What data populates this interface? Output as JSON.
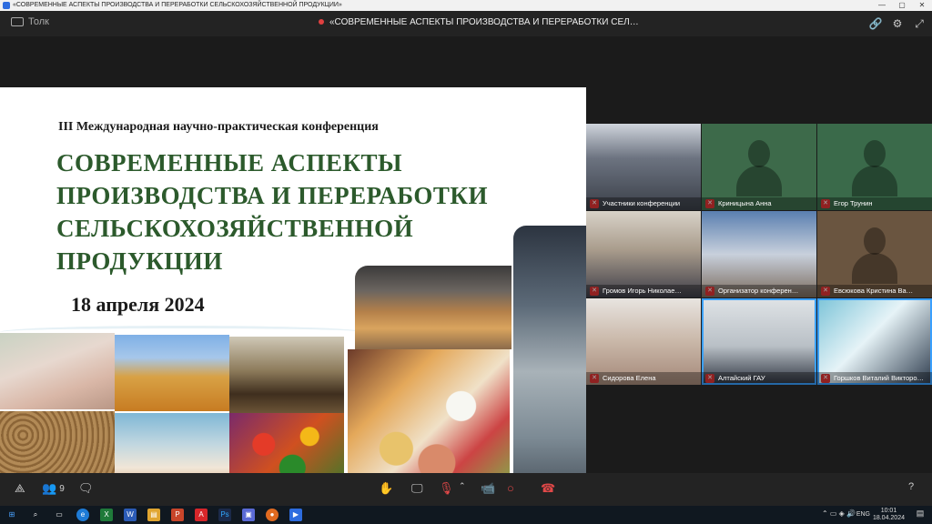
{
  "window": {
    "title": "«СОВРЕМЕННЫЕ АСПЕКТЫ ПРОИЗВОДСТВА И ПЕРЕРАБОТКИ СЕЛЬСКОХОЗЯЙСТВЕННОЙ ПРОДУКЦИИ»",
    "minimize": "—",
    "maximize": "▢",
    "close": "✕"
  },
  "header": {
    "app_name": "Толк",
    "meeting_title": "«СОВРЕМЕННЫЕ АСПЕКТЫ ПРОИЗВОДСТВА И ПЕРЕРАБОТКИ СЕЛ…",
    "recording_color": "#e04040"
  },
  "slide": {
    "subtitle": "III  Международная научно-практическая конференция",
    "title_lines": [
      "СОВРЕМЕННЫЕ АСПЕКТЫ",
      "ПРОИЗВОДСТВА И ПЕРЕРАБОТКИ",
      "СЕЛЬСКОХОЗЯЙСТВЕННОЙ",
      "ПРОДУКЦИИ"
    ],
    "date": "18 апреля 2024",
    "title_color": "#2c5a2c"
  },
  "participants": [
    {
      "name": "Участники конференции",
      "has_video": true
    },
    {
      "name": "Криницына Анна",
      "has_video": false
    },
    {
      "name": "Егор Трунин",
      "has_video": false
    },
    {
      "name": "Громов Игорь Николае…",
      "has_video": true
    },
    {
      "name": "Организатор конферен…",
      "has_video": true
    },
    {
      "name": "Евсюкова Кристина Ва…",
      "has_video": false
    },
    {
      "name": "Сидорова Елена",
      "has_video": true
    },
    {
      "name": "Алтайский ГАУ",
      "has_video": true,
      "active": true
    },
    {
      "name": "Горшков Виталий Викторо…",
      "has_video": true,
      "active": true
    }
  ],
  "toolbar": {
    "participant_count": "9",
    "help": "?"
  },
  "taskbar": {
    "language": "ENG",
    "time": "10:01",
    "date": "18.04.2024"
  }
}
